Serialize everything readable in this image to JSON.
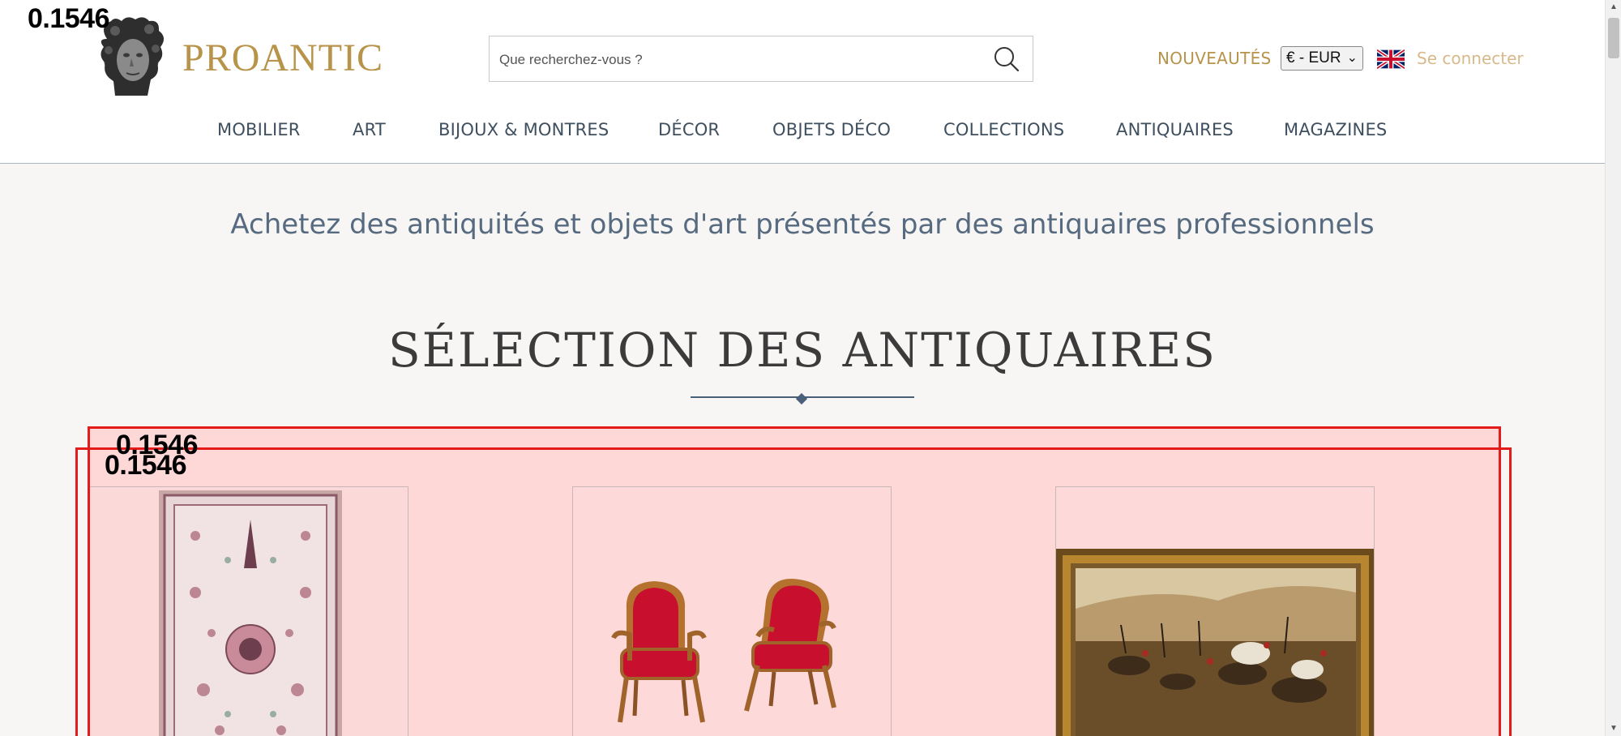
{
  "header": {
    "logo_text": "PROANTIC",
    "search_placeholder": "Que recherchez-vous ?",
    "nouveautes_label": "NOUVEAUTÉS",
    "currency_value": "€ - EUR",
    "connect_label": "Se connecter",
    "language_flag": "uk-flag-icon"
  },
  "nav": {
    "items": [
      "MOBILIER",
      "ART",
      "BIJOUX & MONTRES",
      "DÉCOR",
      "OBJETS DÉCO",
      "COLLECTIONS",
      "ANTIQUAIRES",
      "MAGAZINES"
    ]
  },
  "main": {
    "tagline": "Achetez des antiquités et objets d'art présentés par des antiquaires professionnels",
    "section_title": "SÉLECTION DES ANTIQUAIRES",
    "products": [
      {
        "image": "persian-rug-image"
      },
      {
        "image": "pair-of-armchairs-image"
      },
      {
        "image": "battle-painting-image"
      }
    ]
  },
  "annotations": {
    "score_1": "0.1546",
    "score_2": "0.1546",
    "score_3": "0.1546"
  },
  "colors": {
    "brand_gold": "#b8934a",
    "nav_text": "#3e4f5f",
    "tagline": "#566a80",
    "annotation_red": "#e31b1b"
  }
}
